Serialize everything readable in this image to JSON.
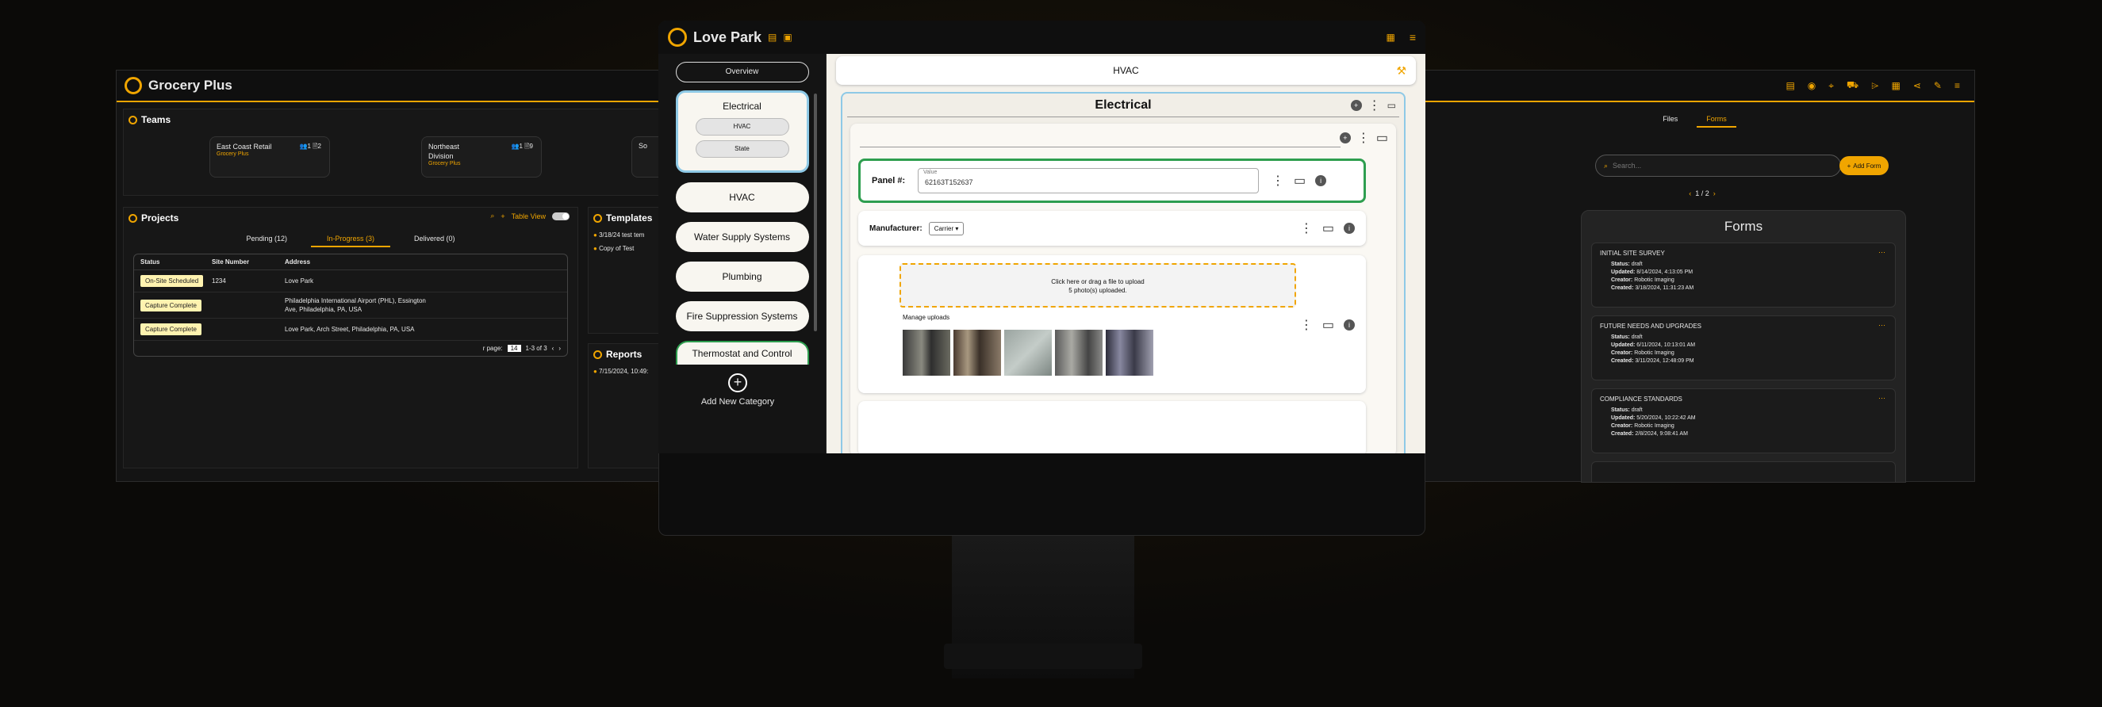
{
  "left": {
    "title": "Grocery Plus",
    "teams_title": "Teams",
    "teams": [
      {
        "name": "East Coast Retail",
        "org": "Grocery Plus",
        "members": "1",
        "sites": "2"
      },
      {
        "name": "Northeast Division",
        "org": "Grocery Plus",
        "members": "1",
        "sites": "9"
      },
      {
        "name": "So",
        "org": "",
        "members": "",
        "sites": ""
      }
    ],
    "projects_title": "Projects",
    "table_view": "Table View",
    "tabs": [
      "Pending (12)",
      "In-Progress (3)",
      "Delivered (0)"
    ],
    "columns": [
      "Status",
      "Site Number",
      "Address"
    ],
    "rows": [
      {
        "status": "On-Site Scheduled",
        "site": "1234",
        "address": "Love Park"
      },
      {
        "status": "Capture Complete",
        "site": "",
        "address": "Philadelphia International Airport (PHL), Essington Ave, Philadelphia, PA, USA"
      },
      {
        "status": "Capture Complete",
        "site": "",
        "address": "Love Park, Arch Street, Philadelphia, PA, USA"
      }
    ],
    "pager_label": "r page:",
    "pager_value": "14",
    "pager_range": "1-3 of 3",
    "templates_title": "Templates",
    "templates": [
      "3/18/24 test tem",
      "Copy of Test"
    ],
    "reports_title": "Reports",
    "reports": [
      "7/15/2024, 10:49:"
    ]
  },
  "center": {
    "title": "Love Park",
    "overview": "Overview",
    "electrical_card": {
      "title": "Electrical",
      "chips": [
        "HVAC",
        "State"
      ]
    },
    "categories": [
      "HVAC",
      "Water Supply Systems",
      "Plumbing",
      "Fire Suppression Systems",
      "Thermostat and Control"
    ],
    "add_category": "Add New Category",
    "header": "HVAC",
    "section": "Electrical",
    "panel_label": "Panel #:",
    "panel_value_label": "Value",
    "panel_value": "62163T152637",
    "manufacturer_label": "Manufacturer:",
    "manufacturer_value": "Carrier",
    "upload_line1": "Click here or drag a file to upload",
    "upload_line2": "5 photo(s) uploaded.",
    "manage": "Manage uploads"
  },
  "right": {
    "tabs": [
      "Files",
      "Forms"
    ],
    "search_placeholder": "Search...",
    "add_form": "Add Form",
    "pager": "1 / 2",
    "forms_title": "Forms",
    "forms": [
      {
        "title": "INITIAL SITE SURVEY",
        "status": "draft",
        "updated": "8/14/2024, 4:13:05 PM",
        "creator": "Robotic Imaging",
        "created": "3/18/2024, 11:31:23 AM"
      },
      {
        "title": "FUTURE NEEDS AND UPGRADES",
        "status": "draft",
        "updated": "6/11/2024, 10:13:01 AM",
        "creator": "Robotic Imaging",
        "created": "3/11/2024, 12:48:09 PM"
      },
      {
        "title": "COMPLIANCE STANDARDS",
        "status": "draft",
        "updated": "5/20/2024, 10:22:42 AM",
        "creator": "Robotic Imaging",
        "created": "2/8/2024, 9:08:41 AM"
      }
    ],
    "labels": {
      "status": "Status:",
      "updated": "Updated:",
      "creator": "Creator:",
      "created": "Created:"
    }
  },
  "colors": {
    "accent": "#f0a500",
    "green": "#2e9e4f",
    "blue": "#8ec9e6"
  }
}
